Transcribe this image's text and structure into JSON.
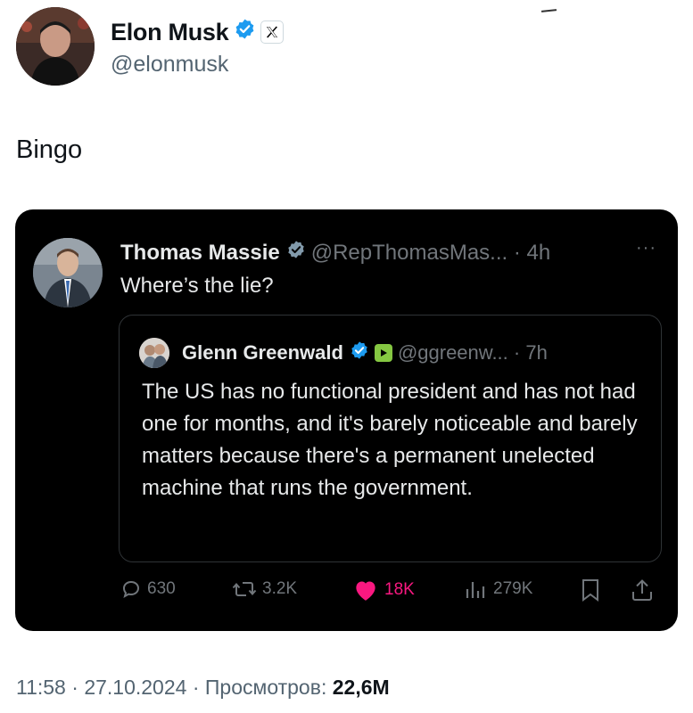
{
  "post": {
    "author_name": "Elon Musk",
    "author_handle": "@elonmusk",
    "text": "Bingo",
    "time": "11:58",
    "date": "27.10.2024",
    "separator": "·",
    "views_label": "Просмотров:",
    "views_count": "22,6M"
  },
  "quoted": {
    "author_name": "Thomas Massie",
    "handle_time": "@RepThomasMas... · 4h",
    "more": "···",
    "text": "Where’s the lie?",
    "inner": {
      "author_name": "Glenn Greenwald",
      "handle_time": "@ggreenw... · 7h",
      "text": "The US has no functional president and has not had one for months, and it's barely noticeable and barely matters because there's a permanent unelected machine that runs the government."
    },
    "actions": {
      "replies": "630",
      "reposts": "3.2K",
      "likes": "18K",
      "views": "279K"
    }
  },
  "colors": {
    "verified": "#1d9bf0",
    "like": "#f91880",
    "card_bg": "#000000",
    "muted": "#71767b"
  },
  "icons": [
    "verified-badge-icon",
    "x-logo-icon",
    "reply-icon",
    "repost-icon",
    "heart-icon",
    "views-icon",
    "bookmark-icon",
    "share-icon",
    "rumble-icon"
  ]
}
